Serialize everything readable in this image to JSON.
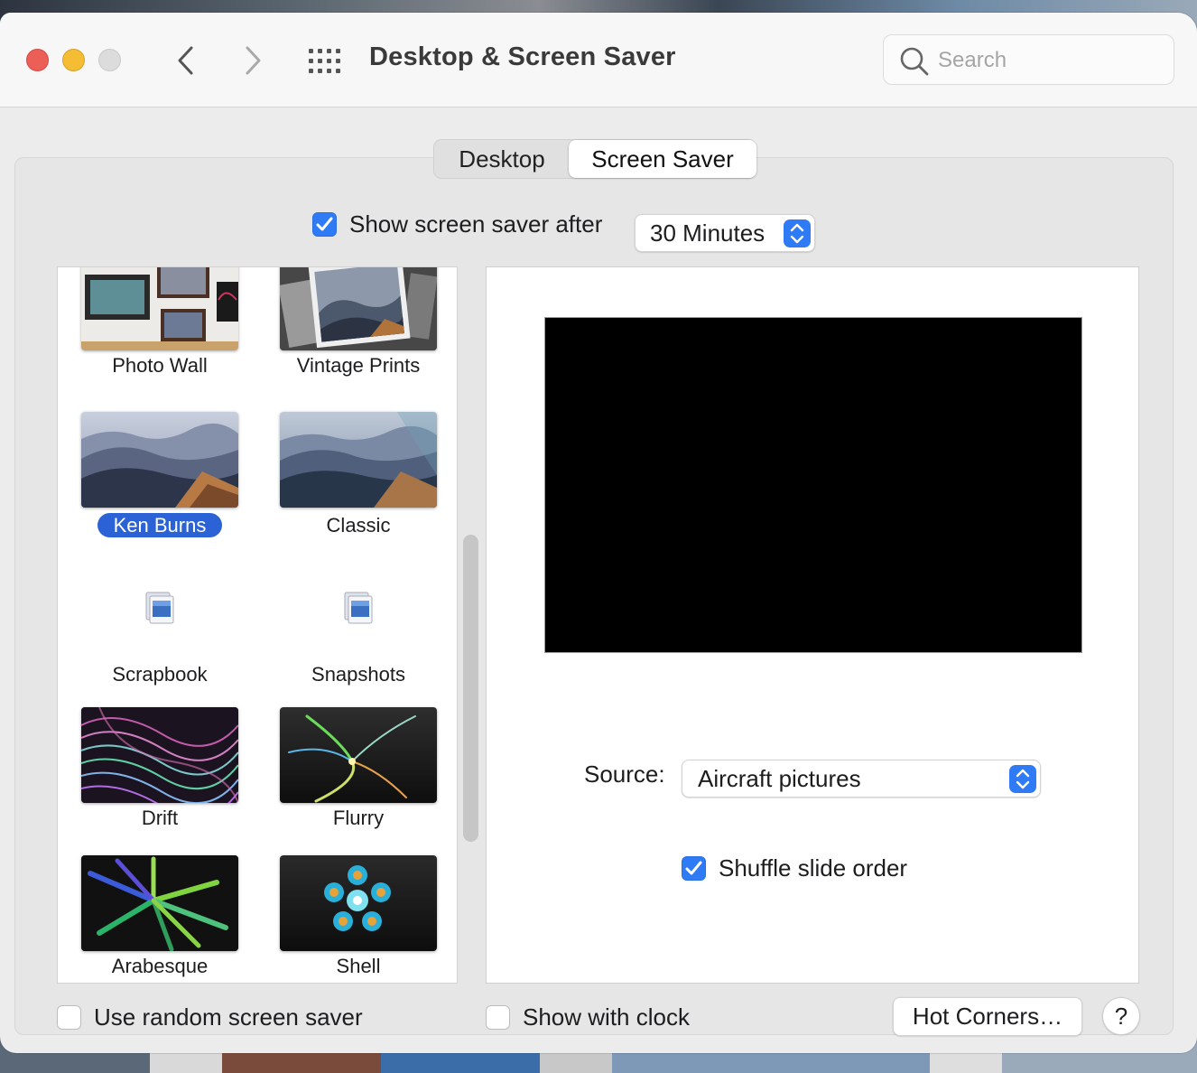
{
  "window": {
    "title": "Desktop & Screen Saver"
  },
  "toolbar": {
    "back_icon": "chevron-left-icon",
    "forward_icon": "chevron-right-icon",
    "show_all_icon": "grid-icon"
  },
  "search": {
    "placeholder": "Search",
    "value": ""
  },
  "tabs": [
    {
      "label": "Desktop",
      "active": false
    },
    {
      "label": "Screen Saver",
      "active": true
    }
  ],
  "screen_saver_after": {
    "checked": true,
    "label": "Show screen saver after",
    "selected": "30 Minutes"
  },
  "screen_savers": [
    {
      "label": "Photo Wall",
      "selected": false
    },
    {
      "label": "Vintage Prints",
      "selected": false
    },
    {
      "label": "Ken Burns",
      "selected": true
    },
    {
      "label": "Classic",
      "selected": false
    },
    {
      "label": "Scrapbook",
      "selected": false
    },
    {
      "label": "Snapshots",
      "selected": false
    },
    {
      "label": "Drift",
      "selected": false
    },
    {
      "label": "Flurry",
      "selected": false
    },
    {
      "label": "Arabesque",
      "selected": false
    },
    {
      "label": "Shell",
      "selected": false
    }
  ],
  "options": {
    "source_label": "Source:",
    "source_value": "Aircraft pictures",
    "shuffle_label": "Shuffle slide order",
    "shuffle_checked": true
  },
  "footer": {
    "random_label": "Use random screen saver",
    "random_checked": false,
    "clock_label": "Show with clock",
    "clock_checked": false,
    "hot_corners_label": "Hot Corners…",
    "help_label": "?"
  },
  "colors": {
    "accent": "#2f7bf5",
    "selection": "#2b62d6",
    "close": "#ec5f57",
    "minimize": "#f4bd34",
    "zoom_disabled": "#dcdcdc"
  }
}
